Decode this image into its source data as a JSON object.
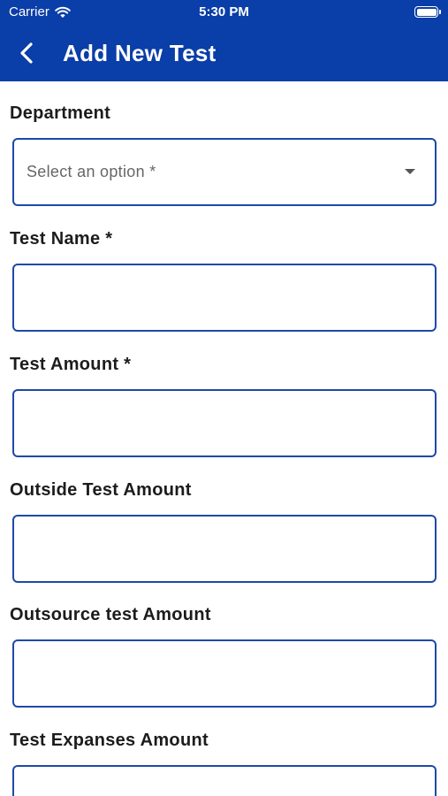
{
  "status_bar": {
    "carrier": "Carrier",
    "time": "5:30 PM",
    "wifi_icon": "wifi-icon",
    "battery_icon": "battery-icon"
  },
  "header": {
    "title": "Add New Test",
    "back_icon": "chevron-left-icon",
    "background_color": "#0a3ea8"
  },
  "form": {
    "department": {
      "label": "Department",
      "selected_text": "Select an option *"
    },
    "test_name": {
      "label": "Test Name *",
      "value": "",
      "placeholder": ""
    },
    "test_amount": {
      "label": "Test Amount *",
      "value": "",
      "placeholder": ""
    },
    "outside_test_amount": {
      "label": "Outside Test Amount",
      "value": "",
      "placeholder": ""
    },
    "outsource_test_amount": {
      "label": "Outsource test Amount",
      "value": "",
      "placeholder": ""
    },
    "test_expanses_amount": {
      "label": "Test Expanses Amount",
      "value": "",
      "placeholder": ""
    }
  },
  "colors": {
    "field_border": "#1e49a8",
    "label_text": "#1c1c1c"
  }
}
